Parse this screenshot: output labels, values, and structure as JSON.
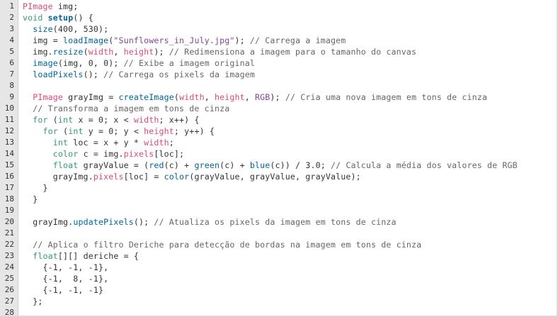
{
  "editor": {
    "colors": {
      "keyword": "#33997e",
      "function": "#006699",
      "string": "#7d4793",
      "comment": "#666666",
      "builtin_var": "#d94a7a",
      "text": "#333333",
      "gutter": "#e6e6e6"
    },
    "lines": [
      {
        "number": "1",
        "tokens": [
          {
            "t": "PImage",
            "c": "pu"
          },
          {
            "t": " img;",
            "c": "txt"
          }
        ]
      },
      {
        "number": "2",
        "tokens": [
          {
            "t": "void",
            "c": "kw"
          },
          {
            "t": " ",
            "c": "txt"
          },
          {
            "t": "setup",
            "c": "fnb"
          },
          {
            "t": "() {",
            "c": "txt"
          }
        ]
      },
      {
        "number": "3",
        "tokens": [
          {
            "t": "  ",
            "c": "txt"
          },
          {
            "t": "size",
            "c": "fn"
          },
          {
            "t": "(400, 530);",
            "c": "txt"
          }
        ]
      },
      {
        "number": "4",
        "tokens": [
          {
            "t": "  img = ",
            "c": "txt"
          },
          {
            "t": "loadImage",
            "c": "fn"
          },
          {
            "t": "(",
            "c": "txt"
          },
          {
            "t": "\"Sunflowers_in_July.jpg\"",
            "c": "str"
          },
          {
            "t": "); ",
            "c": "txt"
          },
          {
            "t": "// Carrega a imagem",
            "c": "com"
          }
        ]
      },
      {
        "number": "5",
        "tokens": [
          {
            "t": "  img.",
            "c": "txt"
          },
          {
            "t": "resize",
            "c": "fn"
          },
          {
            "t": "(",
            "c": "txt"
          },
          {
            "t": "width",
            "c": "var"
          },
          {
            "t": ", ",
            "c": "txt"
          },
          {
            "t": "height",
            "c": "var"
          },
          {
            "t": "); ",
            "c": "txt"
          },
          {
            "t": "// Redimensiona a imagem para o tamanho do canvas",
            "c": "com"
          }
        ]
      },
      {
        "number": "6",
        "tokens": [
          {
            "t": "  ",
            "c": "txt"
          },
          {
            "t": "image",
            "c": "fn"
          },
          {
            "t": "(img, 0, 0); ",
            "c": "txt"
          },
          {
            "t": "// Exibe a imagem original",
            "c": "com"
          }
        ]
      },
      {
        "number": "7",
        "tokens": [
          {
            "t": "  ",
            "c": "txt"
          },
          {
            "t": "loadPixels",
            "c": "fn"
          },
          {
            "t": "(); ",
            "c": "txt"
          },
          {
            "t": "// Carrega os pixels da imagem",
            "c": "com"
          }
        ]
      },
      {
        "number": "8",
        "tokens": []
      },
      {
        "number": "9",
        "tokens": [
          {
            "t": "  ",
            "c": "txt"
          },
          {
            "t": "PImage",
            "c": "pu"
          },
          {
            "t": " grayImg = ",
            "c": "txt"
          },
          {
            "t": "createImage",
            "c": "fn"
          },
          {
            "t": "(",
            "c": "txt"
          },
          {
            "t": "width",
            "c": "var"
          },
          {
            "t": ", ",
            "c": "txt"
          },
          {
            "t": "height",
            "c": "var"
          },
          {
            "t": ", ",
            "c": "txt"
          },
          {
            "t": "RGB",
            "c": "str"
          },
          {
            "t": "); ",
            "c": "txt"
          },
          {
            "t": "// Cria uma nova imagem em tons de cinza",
            "c": "com"
          }
        ]
      },
      {
        "number": "10",
        "tokens": [
          {
            "t": "  ",
            "c": "txt"
          },
          {
            "t": "// Transforma a imagem em tons de cinza",
            "c": "com"
          }
        ]
      },
      {
        "number": "11",
        "tokens": [
          {
            "t": "  ",
            "c": "txt"
          },
          {
            "t": "for",
            "c": "kw"
          },
          {
            "t": " (",
            "c": "txt"
          },
          {
            "t": "int",
            "c": "kw"
          },
          {
            "t": " x = 0; x < ",
            "c": "txt"
          },
          {
            "t": "width",
            "c": "var"
          },
          {
            "t": "; x++) {",
            "c": "txt"
          }
        ]
      },
      {
        "number": "12",
        "tokens": [
          {
            "t": "    ",
            "c": "txt"
          },
          {
            "t": "for",
            "c": "kw"
          },
          {
            "t": " (",
            "c": "txt"
          },
          {
            "t": "int",
            "c": "kw"
          },
          {
            "t": " y = 0; y < ",
            "c": "txt"
          },
          {
            "t": "height",
            "c": "var"
          },
          {
            "t": "; y++) {",
            "c": "txt"
          }
        ]
      },
      {
        "number": "13",
        "tokens": [
          {
            "t": "      ",
            "c": "txt"
          },
          {
            "t": "int",
            "c": "kw"
          },
          {
            "t": " loc = x + y * ",
            "c": "txt"
          },
          {
            "t": "width",
            "c": "var"
          },
          {
            "t": ";",
            "c": "txt"
          }
        ]
      },
      {
        "number": "14",
        "tokens": [
          {
            "t": "      ",
            "c": "txt"
          },
          {
            "t": "color",
            "c": "kw"
          },
          {
            "t": " c = img.",
            "c": "txt"
          },
          {
            "t": "pixels",
            "c": "var"
          },
          {
            "t": "[loc];",
            "c": "txt"
          }
        ]
      },
      {
        "number": "15",
        "tokens": [
          {
            "t": "      ",
            "c": "txt"
          },
          {
            "t": "float",
            "c": "kw"
          },
          {
            "t": " grayValue = (",
            "c": "txt"
          },
          {
            "t": "red",
            "c": "fn"
          },
          {
            "t": "(c) + ",
            "c": "txt"
          },
          {
            "t": "green",
            "c": "fn"
          },
          {
            "t": "(c) + ",
            "c": "txt"
          },
          {
            "t": "blue",
            "c": "fn"
          },
          {
            "t": "(c)) / 3.0; ",
            "c": "txt"
          },
          {
            "t": "// Calcula a média dos valores de RGB",
            "c": "com"
          }
        ]
      },
      {
        "number": "16",
        "tokens": [
          {
            "t": "      grayImg.",
            "c": "txt"
          },
          {
            "t": "pixels",
            "c": "var"
          },
          {
            "t": "[loc] = ",
            "c": "txt"
          },
          {
            "t": "color",
            "c": "fn"
          },
          {
            "t": "(grayValue, grayValue, grayValue);",
            "c": "txt"
          }
        ]
      },
      {
        "number": "17",
        "tokens": [
          {
            "t": "    }",
            "c": "txt"
          }
        ]
      },
      {
        "number": "18",
        "tokens": [
          {
            "t": "  }",
            "c": "txt"
          }
        ]
      },
      {
        "number": "19",
        "tokens": []
      },
      {
        "number": "20",
        "tokens": [
          {
            "t": "  grayImg.",
            "c": "txt"
          },
          {
            "t": "updatePixels",
            "c": "fn"
          },
          {
            "t": "(); ",
            "c": "txt"
          },
          {
            "t": "// Atualiza os pixels da imagem em tons de cinza",
            "c": "com"
          }
        ]
      },
      {
        "number": "21",
        "tokens": []
      },
      {
        "number": "22",
        "tokens": [
          {
            "t": "  ",
            "c": "txt"
          },
          {
            "t": "// Aplica o filtro Deriche para detecção de bordas na imagem em tons de cinza",
            "c": "com"
          }
        ]
      },
      {
        "number": "23",
        "tokens": [
          {
            "t": "  ",
            "c": "txt"
          },
          {
            "t": "float",
            "c": "kw"
          },
          {
            "t": "[][] deriche = {",
            "c": "txt"
          }
        ]
      },
      {
        "number": "24",
        "tokens": [
          {
            "t": "    {-1, -1, -1},",
            "c": "txt"
          }
        ]
      },
      {
        "number": "25",
        "tokens": [
          {
            "t": "    {-1,  8, -1},",
            "c": "txt"
          }
        ]
      },
      {
        "number": "26",
        "tokens": [
          {
            "t": "    {-1, -1, -1}",
            "c": "txt"
          }
        ]
      },
      {
        "number": "27",
        "tokens": [
          {
            "t": "  };",
            "c": "txt"
          }
        ]
      },
      {
        "number": "28",
        "tokens": []
      }
    ]
  }
}
